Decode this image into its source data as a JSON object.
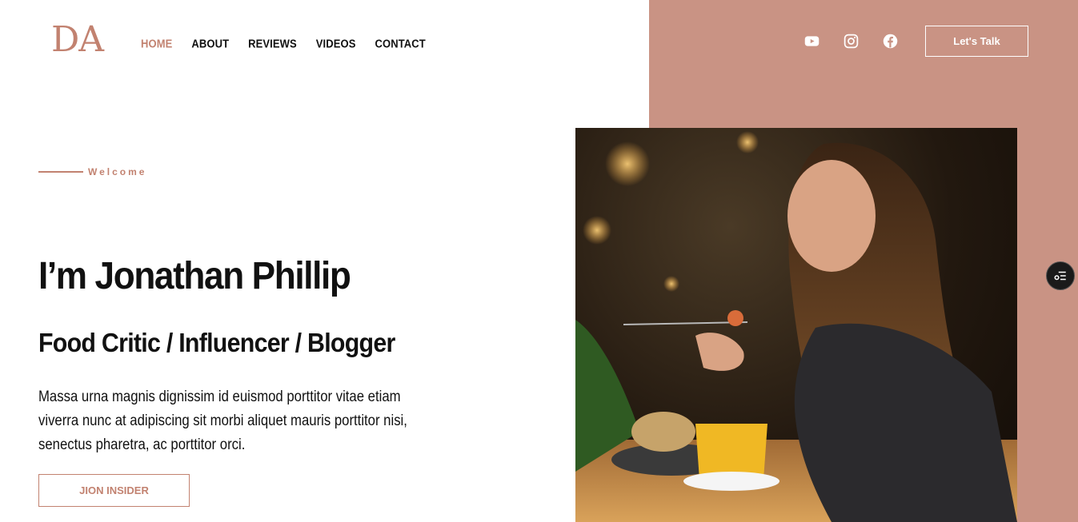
{
  "brand": {
    "logo_text": "DA",
    "accent_color": "#c99384"
  },
  "nav": {
    "items": [
      {
        "label": "HOME",
        "active": true
      },
      {
        "label": "ABOUT",
        "active": false
      },
      {
        "label": "REVIEWS",
        "active": false
      },
      {
        "label": "VIDEOS",
        "active": false
      },
      {
        "label": "CONTACT",
        "active": false
      }
    ]
  },
  "social": {
    "icons": [
      "youtube-icon",
      "instagram-icon",
      "facebook-icon"
    ]
  },
  "header": {
    "cta_label": "Let's Talk"
  },
  "hero": {
    "eyebrow": "Welcome",
    "title": "I’m Jonathan Phillip",
    "subtitle": "Food Critic / Influencer / Blogger",
    "description": "Massa urna magnis dignissim id euismod porttitor vitae etiam viverra nunc at adipiscing sit morbi aliquet mauris porttitor nisi, senectus pharetra, ac porttitor orci.",
    "button_label": "JION INSIDER"
  },
  "photo": {
    "subject": "woman-eating-pasta-photo"
  },
  "floating": {
    "icon": "list-settings-icon"
  }
}
